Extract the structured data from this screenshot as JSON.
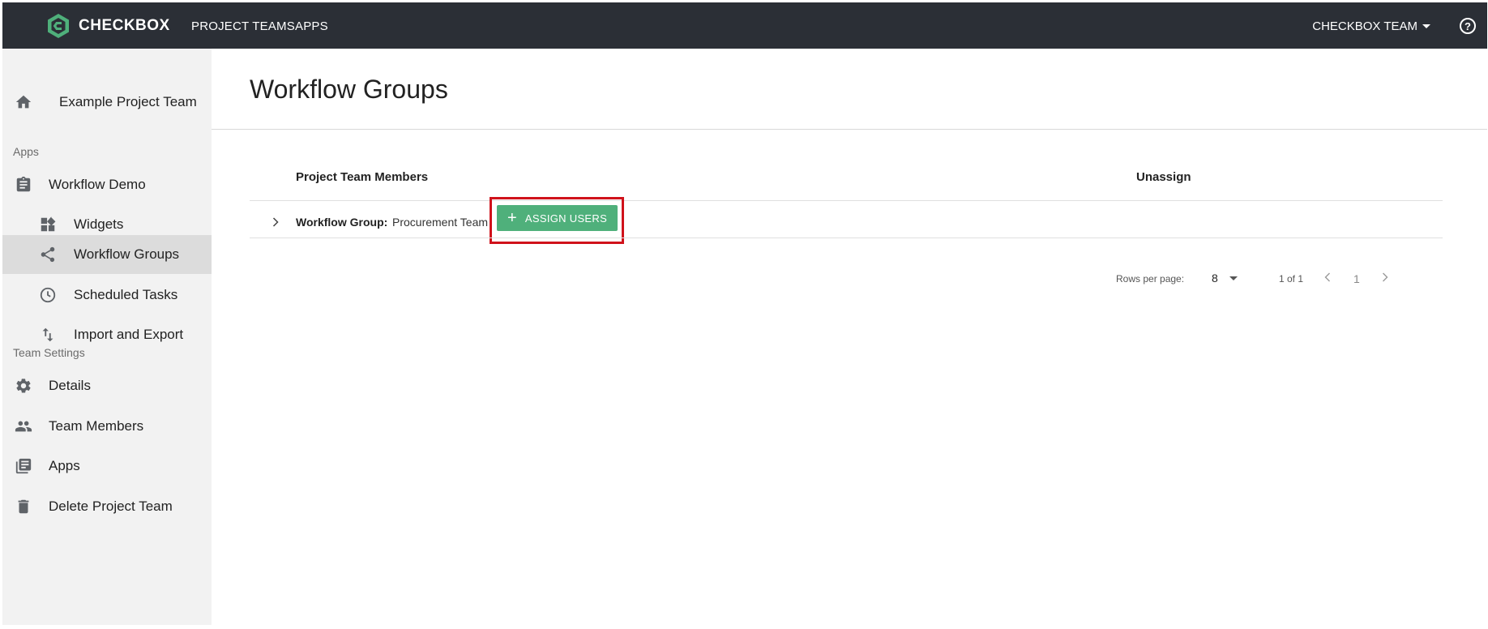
{
  "app": {
    "brand": "CHECKBOX",
    "accent_color": "#4fb07b",
    "topbar_color": "#2b2f36",
    "highlight_color": "#d0121b"
  },
  "topbar": {
    "nav": [
      {
        "label": "PROJECT TEAMS"
      },
      {
        "label": "APPS"
      }
    ],
    "team_menu": "CHECKBOX TEAM",
    "help_icon": "question-circle-icon"
  },
  "sidebar": {
    "home": {
      "label": "Example Project Team",
      "icon": "home-icon"
    },
    "apps_section": "Apps",
    "apps_items": [
      {
        "label": "Workflow Demo",
        "icon": "clipboard-icon"
      },
      {
        "label": "Widgets",
        "icon": "widgets-icon"
      },
      {
        "label": "Workflow Groups",
        "icon": "share-icon",
        "active": true
      },
      {
        "label": "Scheduled Tasks",
        "icon": "clock-icon"
      },
      {
        "label": "Import and Export",
        "icon": "import-export-icon"
      }
    ],
    "settings_section": "Team Settings",
    "settings_items": [
      {
        "label": "Details",
        "icon": "gear-icon"
      },
      {
        "label": "Team Members",
        "icon": "people-icon"
      },
      {
        "label": "Apps",
        "icon": "library-icon"
      },
      {
        "label": "Delete Project Team",
        "icon": "trash-icon"
      }
    ]
  },
  "main": {
    "title": "Workflow Groups",
    "table": {
      "columns": [
        "Project Team Members",
        "Unassign"
      ],
      "rows": [
        {
          "group_label": "Workflow Group:",
          "group_name": "Procurement Team",
          "action_label": "ASSIGN USERS"
        }
      ]
    },
    "pagination": {
      "rows_per_page_label": "Rows per page:",
      "rows_per_page": "8",
      "range": "1 of 1",
      "current_page": "1"
    }
  }
}
